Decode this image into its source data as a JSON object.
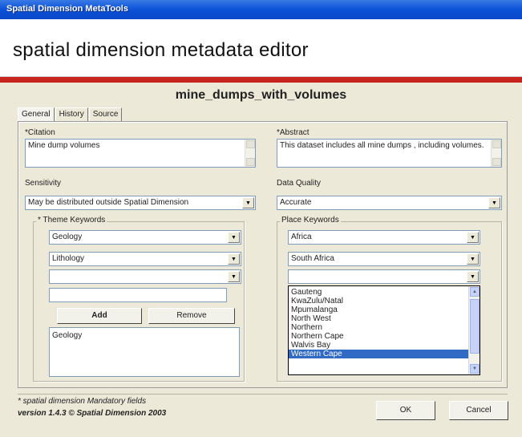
{
  "window": {
    "title": "Spatial Dimension MetaTools"
  },
  "header": {
    "app_name": "spatial dimension metadata editor"
  },
  "dataset": {
    "name": "mine_dumps_with_volumes"
  },
  "tabs": [
    {
      "label": "General",
      "active": true
    },
    {
      "label": "History",
      "active": false
    },
    {
      "label": "Source",
      "active": false
    }
  ],
  "citation": {
    "label": "*Citation",
    "value": "Mine dump volumes"
  },
  "abstract": {
    "label": "*Abstract",
    "value": "This dataset includes all mine dumps , including volumes."
  },
  "sensitivity": {
    "label": "Sensitivity",
    "value": "May be distributed outside Spatial Dimension"
  },
  "data_quality": {
    "label": "Data Quality",
    "value": "Accurate"
  },
  "theme_keywords": {
    "title": "* Theme Keywords",
    "combos": [
      "Geology",
      "Lithology",
      ""
    ],
    "new_keyword": "",
    "add_label": "Add",
    "remove_label": "Remove",
    "selected": [
      "Geology"
    ]
  },
  "place_keywords": {
    "title": "Place Keywords",
    "combos": [
      "Africa",
      "South Africa",
      ""
    ],
    "dropdown_items": [
      {
        "label": "Gauteng",
        "selected": false
      },
      {
        "label": "KwaZulu/Natal",
        "selected": false
      },
      {
        "label": "Mpumalanga",
        "selected": false
      },
      {
        "label": "North West",
        "selected": false
      },
      {
        "label": "Northern",
        "selected": false
      },
      {
        "label": "Northern Cape",
        "selected": false
      },
      {
        "label": "Walvis Bay",
        "selected": false
      },
      {
        "label": "Western Cape",
        "selected": true
      }
    ]
  },
  "footer": {
    "mandatory_note": "* spatial dimension Mandatory fields",
    "version": "version 1.4.3  © Spatial Dimension 2003",
    "ok_label": "OK",
    "cancel_label": "Cancel"
  },
  "colors": {
    "titlebar": "#0a52d8",
    "accent_bar": "#c8231d",
    "selection": "#316ac5"
  }
}
